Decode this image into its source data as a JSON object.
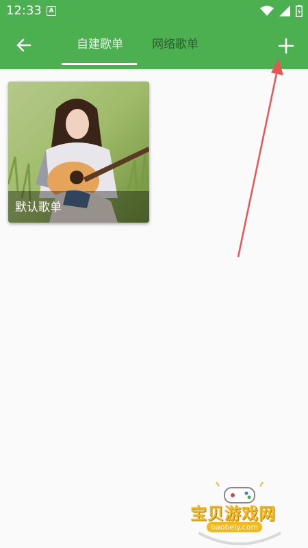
{
  "status_bar": {
    "time": "12:33",
    "notification_icon_text": "A",
    "icons": [
      "wifi-icon",
      "signal-icon",
      "battery-icon"
    ]
  },
  "app_bar": {
    "color": "#4caf50",
    "tabs": [
      {
        "label": "自建歌单",
        "selected": true
      },
      {
        "label": "网络歌单",
        "selected": false
      }
    ]
  },
  "playlists": [
    {
      "title": "默认歌单"
    }
  ],
  "watermark": {
    "title": "宝贝游戏网",
    "url": "baobeiy.com"
  }
}
